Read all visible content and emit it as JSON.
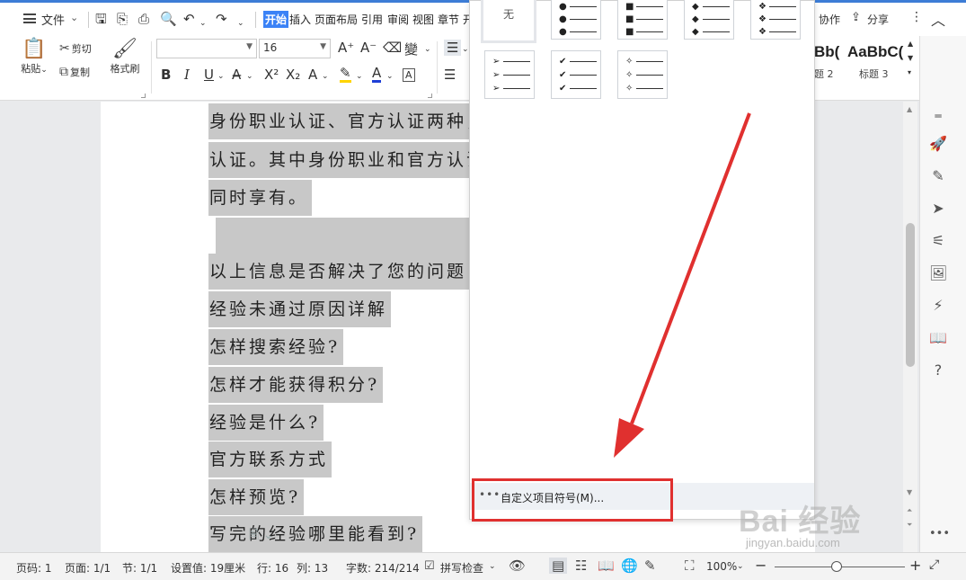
{
  "menubar": {
    "file_label": "文件",
    "tabs": [
      "开始",
      "插入",
      "页面布局",
      "引用",
      "审阅",
      "视图",
      "章节"
    ],
    "tab_partial": "开",
    "cooperate": "协作",
    "share": "分享"
  },
  "ribbon": {
    "paste": "粘贴",
    "cut": "剪切",
    "copy": "复制",
    "format_painter": "格式刷",
    "font_name": "",
    "font_size": "16",
    "bold": "B",
    "italic": "I",
    "underline": "U",
    "style_previews": [
      "Bb(",
      "AaBbC("
    ],
    "style_labels": [
      "题 2",
      "标题 3"
    ],
    "wen": "文"
  },
  "document": {
    "lines": [
      "身份职业认证、官方认证两种，",
      "认证。其中身份职业和官方认证",
      "同时享有。",
      "",
      "以上信息是否解决了您的问题",
      "经验未通过原因详解",
      "怎样搜索经验?",
      "怎样才能获得积分?",
      "经验是什么?",
      "官方联系方式",
      "怎样预览?",
      "写完的经验哪里能看到?"
    ],
    "partial_char": "："
  },
  "bullet_dropdown": {
    "none_label": "无",
    "options": [
      {
        "symbol": "●"
      },
      {
        "symbol": "■"
      },
      {
        "symbol": "◆"
      },
      {
        "symbol": "❖"
      },
      {
        "symbol": "➢"
      },
      {
        "symbol": "✔"
      },
      {
        "symbol": "✧"
      }
    ],
    "custom_dots": "•••",
    "custom_label": "自定义项目符号(M)..."
  },
  "statusbar": {
    "page_num": "页码: 1",
    "pages": "页面: 1/1",
    "section": "节: 1/1",
    "setting": "设置值: 19厘米",
    "row": "行: 16",
    "col": "列: 13",
    "words": "字数: 214/214",
    "spell": "拼写检查",
    "zoom": "100%"
  },
  "watermark": {
    "logo": "Bai 经验",
    "url": "jingyan.baidu.com"
  },
  "colors": {
    "accent": "#3b82f6",
    "highlight": "#c8c8c8",
    "annotation": "#e0302f"
  }
}
